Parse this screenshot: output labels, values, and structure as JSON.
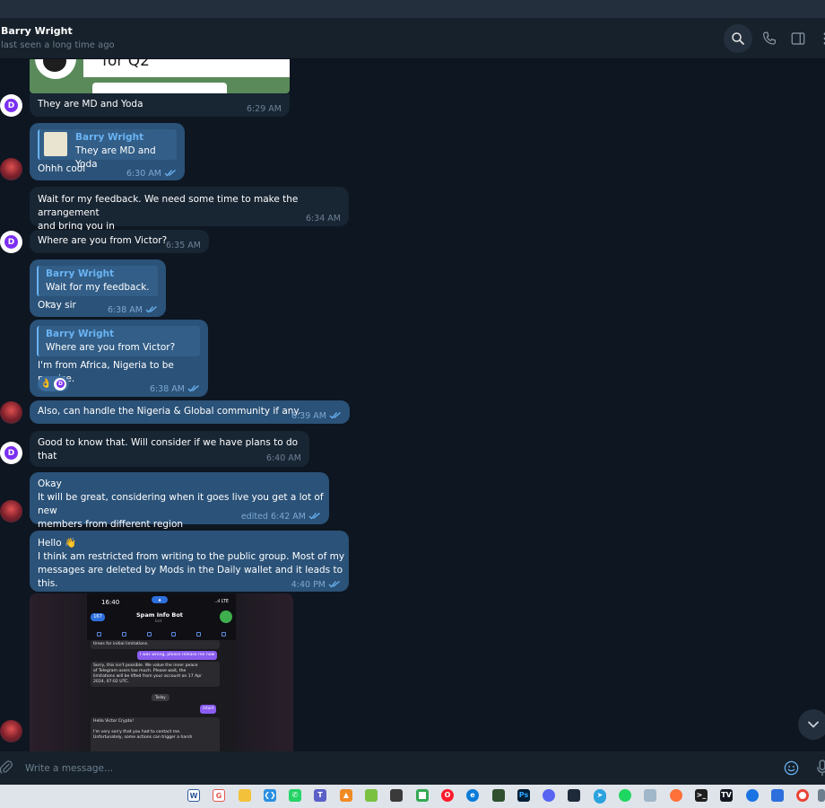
{
  "header": {
    "contact_name": "Barry Wright",
    "status": "last seen a long time ago"
  },
  "preview": {
    "text": "for Q2"
  },
  "messages": [
    {
      "id": "m1",
      "direction": "in",
      "text": "They are MD and Yoda",
      "time": "6:29 AM"
    },
    {
      "id": "m2",
      "direction": "out",
      "reply_name": "Barry Wright",
      "reply_text": "They are MD and Yoda",
      "text": "Ohhh cool",
      "time": "6:30 AM"
    },
    {
      "id": "m3",
      "direction": "in",
      "text": "Wait for my feedback. We need some time to make the arrangement\nand bring you in",
      "time": "6:34 AM"
    },
    {
      "id": "m4",
      "direction": "in",
      "text": "Where are you from Victor?",
      "time": "6:35 AM"
    },
    {
      "id": "m5",
      "direction": "out",
      "reply_name": "Barry Wright",
      "reply_text": "Wait for my feedback. ...",
      "text": "Okay sir",
      "time": "6:38 AM"
    },
    {
      "id": "m6",
      "direction": "out",
      "reply_name": "Barry Wright",
      "reply_text": "Where are you from Victor?",
      "text": "I'm from Africa, Nigeria to be precise.",
      "time": "6:38 AM",
      "reaction": "👌"
    },
    {
      "id": "m7",
      "direction": "out",
      "text": "Also, can handle the Nigeria & Global community if any.",
      "time": "6:39 AM"
    },
    {
      "id": "m8",
      "direction": "in",
      "text": "Good to know that. Will consider if we have plans to do that",
      "time": "6:40 AM"
    },
    {
      "id": "m9",
      "direction": "out",
      "text": "Okay\nIt will be great, considering when it goes live you get a lot of new\nmembers from different region",
      "time": "edited 6:42 AM"
    },
    {
      "id": "m10",
      "direction": "out",
      "text": "Hello 👋\nI think am restricted from writing to the public group. Most of my\nmessages are deleted by Mods in the Daily wallet and it leads to this.",
      "time": "4:40 PM"
    }
  ],
  "screenshot": {
    "time": "16:40",
    "signal": "..ıl LTE",
    "back_label": "167",
    "title": "Spam Info Bot",
    "subtitle": "bot",
    "bubble1": "times for initial limitations.",
    "bubble2": "I was wrong, please release me now",
    "bubble3": "Sorry, this isn't possible. We value the inner peace\nof Telegram users too much. Please wait, the\nlimitations will be lifted from your account on 17 Apr\n2024, 07:02 UTC.",
    "today": "Today",
    "start": "/start",
    "bubble4": "Hello Victor Crypto!\n\nI'm very sorry that you had to contact me.\nUnfortunately, some actions can trigger a harsh"
  },
  "composer": {
    "placeholder": "Write a message..."
  },
  "colors": {
    "background": "#0e1621",
    "incoming_bubble": "#182533",
    "outgoing_bubble": "#2b5278",
    "accent": "#6ab3f3"
  }
}
